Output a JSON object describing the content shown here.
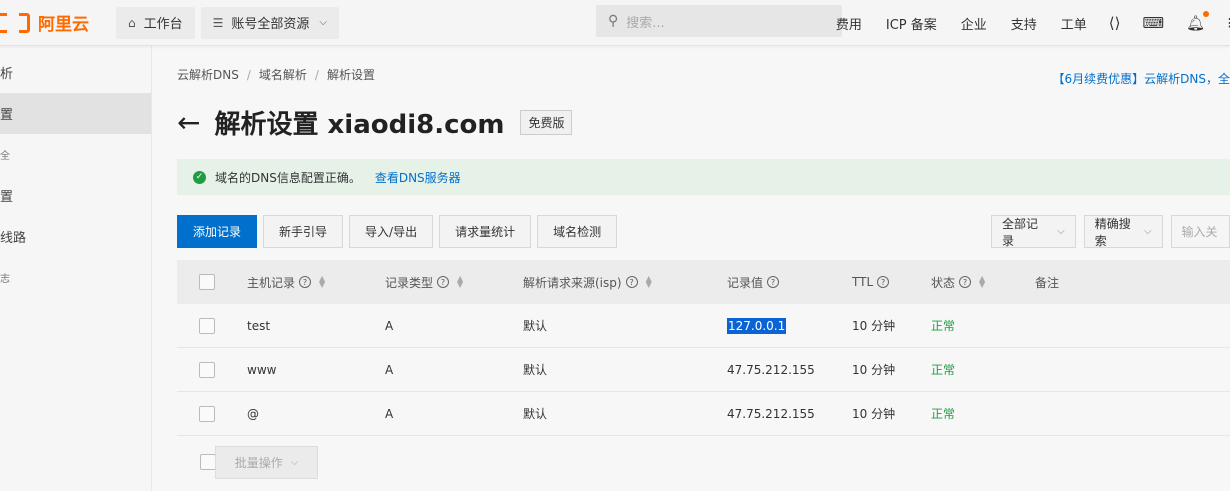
{
  "topbar": {
    "logo_text": "阿里云",
    "workbench": "工作台",
    "resources": "账号全部资源",
    "search_placeholder": "搜索...",
    "links": [
      "费用",
      "ICP 备案",
      "企业",
      "支持",
      "工单"
    ],
    "accent": "#ff6a00"
  },
  "sidebar": {
    "items": [
      "析",
      "置",
      "全",
      "置",
      "线路",
      "志"
    ]
  },
  "breadcrumb": [
    "云解析DNS",
    "域名解析",
    "解析设置"
  ],
  "promo": "【6月续费优惠】云解析DNS，全",
  "title": "解析设置 xiaodi8.com",
  "edition": "免费版",
  "alert": {
    "message": "域名的DNS信息配置正确。",
    "link": "查看DNS服务器"
  },
  "toolbar": {
    "buttons": [
      "添加记录",
      "新手引导",
      "导入/导出",
      "请求量统计",
      "域名检测"
    ],
    "filter_all": "全部记录",
    "filter_search": "精确搜索",
    "input_placeholder": "输入关"
  },
  "table": {
    "headers": [
      "主机记录",
      "记录类型",
      "解析请求来源(isp)",
      "记录值",
      "TTL",
      "状态",
      "备注"
    ],
    "rows": [
      {
        "host": "test",
        "type": "A",
        "isp": "默认",
        "value": "127.0.0.1",
        "ttl": "10 分钟",
        "status": "正常"
      },
      {
        "host": "www",
        "type": "A",
        "isp": "默认",
        "value": "47.75.212.155",
        "ttl": "10 分钟",
        "status": "正常"
      },
      {
        "host": "@",
        "type": "A",
        "isp": "默认",
        "value": "47.75.212.155",
        "ttl": "10 分钟",
        "status": "正常"
      }
    ],
    "batch_label": "批量操作"
  },
  "colors": {
    "primary": "#0070cc",
    "success": "#1f9c44"
  }
}
